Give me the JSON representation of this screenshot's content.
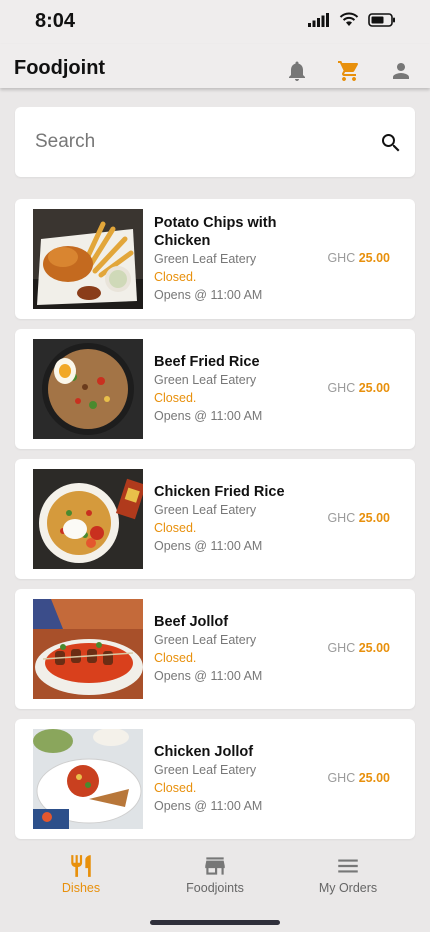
{
  "status_bar": {
    "time": "8:04"
  },
  "app_bar": {
    "title": "Foodjoint",
    "icons": [
      "bell-icon",
      "cart-icon",
      "account-icon"
    ]
  },
  "search": {
    "placeholder": "Search"
  },
  "colors": {
    "accent": "#e8900c",
    "muted_text": "#777777",
    "background": "#eae8e8"
  },
  "dishes": [
    {
      "name": "Potato Chips with Chicken",
      "eatery": "Green Leaf Eatery",
      "status": "Closed.",
      "opens": "Opens @ 11:00 AM",
      "currency": "GHC",
      "price": "25.00"
    },
    {
      "name": "Beef Fried Rice",
      "eatery": "Green Leaf Eatery",
      "status": "Closed.",
      "opens": "Opens @ 11:00 AM",
      "currency": "GHC",
      "price": "25.00"
    },
    {
      "name": "Chicken Fried Rice",
      "eatery": "Green Leaf Eatery",
      "status": "Closed.",
      "opens": "Opens @ 11:00 AM",
      "currency": "GHC",
      "price": "25.00"
    },
    {
      "name": "Beef Jollof",
      "eatery": "Green Leaf Eatery",
      "status": "Closed.",
      "opens": "Opens @ 11:00 AM",
      "currency": "GHC",
      "price": "25.00"
    },
    {
      "name": "Chicken Jollof",
      "eatery": "Green Leaf Eatery",
      "status": "Closed.",
      "opens": "Opens @ 11:00 AM",
      "currency": "GHC",
      "price": "25.00"
    }
  ],
  "bottom_nav": [
    {
      "label": "Dishes",
      "icon": "fork-knife-icon",
      "active": true
    },
    {
      "label": "Foodjoints",
      "icon": "storefront-icon",
      "active": false
    },
    {
      "label": "My Orders",
      "icon": "menu-lines-icon",
      "active": false
    }
  ]
}
